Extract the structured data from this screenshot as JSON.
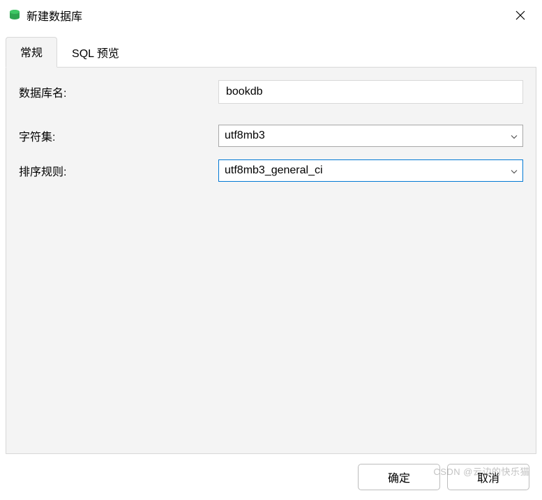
{
  "window": {
    "title": "新建数据库"
  },
  "tabs": {
    "general": "常规",
    "sql_preview": "SQL 预览"
  },
  "form": {
    "db_name_label": "数据库名:",
    "db_name_value": "bookdb",
    "charset_label": "字符集:",
    "charset_value": "utf8mb3",
    "collation_label": "排序规则:",
    "collation_value": "utf8mb3_general_ci"
  },
  "footer": {
    "ok": "确定",
    "cancel": "取消"
  },
  "watermark": "CSDN @云边的快乐猫"
}
